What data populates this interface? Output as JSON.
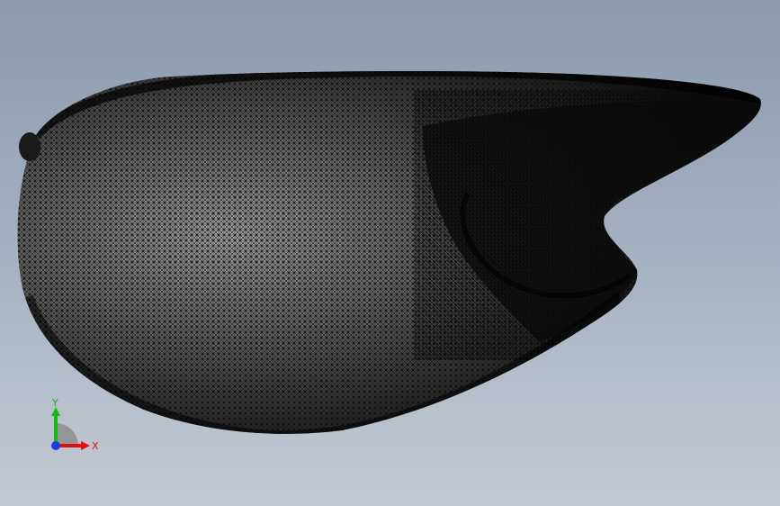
{
  "viewport": {
    "background_top": "#8b9aae",
    "background_bottom": "#c3c9d3"
  },
  "model": {
    "icon": "mesh-shell",
    "mesh_color": "#111111",
    "shade_light": "#9a9a9a",
    "shade_dark": "#1a1a1a"
  },
  "triad": {
    "x_label": "X",
    "y_label": "Y",
    "x_color": "#e01010",
    "y_color": "#14b814",
    "z_color": "#1a3fe0"
  }
}
